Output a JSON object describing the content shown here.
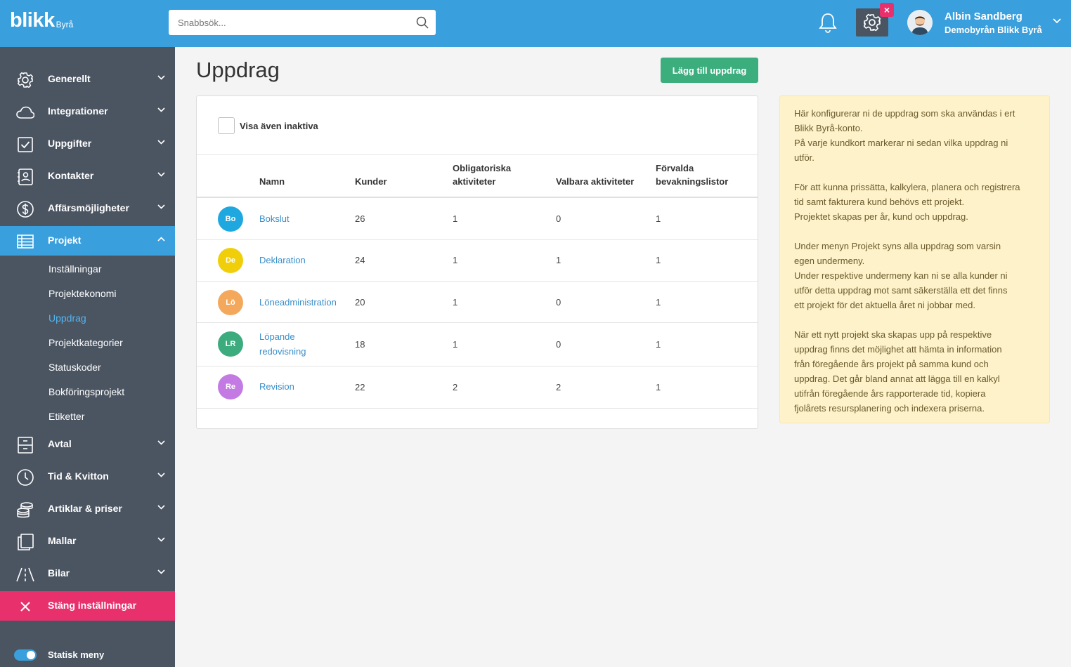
{
  "header": {
    "logo_text": "blikk",
    "logo_sub": "Byrå",
    "search_placeholder": "Snabbsök...",
    "user_name": "Albin Sandberg",
    "user_org": "Demobyrån Blikk Byrå"
  },
  "sidebar": {
    "items": [
      {
        "label": "Generellt",
        "icon": "gear-icon"
      },
      {
        "label": "Integrationer",
        "icon": "cloud-icon"
      },
      {
        "label": "Uppgifter",
        "icon": "checkbox-icon"
      },
      {
        "label": "Kontakter",
        "icon": "contact-card-icon"
      },
      {
        "label": "Affärsmöjligheter",
        "icon": "dollar-icon"
      },
      {
        "label": "Projekt",
        "icon": "table-icon"
      },
      {
        "label": "Avtal",
        "icon": "cabinet-icon"
      },
      {
        "label": "Tid & Kvitton",
        "icon": "clock-icon"
      },
      {
        "label": "Artiklar & priser",
        "icon": "coins-icon"
      },
      {
        "label": "Mallar",
        "icon": "copy-icon"
      },
      {
        "label": "Bilar",
        "icon": "road-icon"
      }
    ],
    "subitems": [
      "Inställningar",
      "Projektekonomi",
      "Uppdrag",
      "Projektkategorier",
      "Statuskoder",
      "Bokföringsprojekt",
      "Etiketter"
    ],
    "close_label": "Stäng inställningar",
    "static_menu_label": "Statisk meny"
  },
  "main": {
    "title": "Uppdrag",
    "add_button": "Lägg till uppdrag",
    "show_inactive_label": "Visa även inaktiva",
    "columns": {
      "name": "Namn",
      "customers": "Kunder",
      "mandatory_l1": "Obligatoriska",
      "mandatory_l2": "aktiviteter",
      "optional": "Valbara aktiviteter",
      "default_l1": "Förvalda",
      "default_l2": "bevakningslistor"
    },
    "rows": [
      {
        "initials": "Bo",
        "color": "#1fa8df",
        "name_l1": "Bokslut",
        "name_l2": "",
        "customers": "26",
        "mandatory": "1",
        "optional": "0",
        "default": "1"
      },
      {
        "initials": "De",
        "color": "#f0cf0a",
        "name_l1": "Deklaration",
        "name_l2": "",
        "customers": "24",
        "mandatory": "1",
        "optional": "1",
        "default": "1"
      },
      {
        "initials": "Lö",
        "color": "#f4a85c",
        "name_l1": "Löneadministration",
        "name_l2": "",
        "customers": "20",
        "mandatory": "1",
        "optional": "0",
        "default": "1"
      },
      {
        "initials": "LR",
        "color": "#3cab7e",
        "name_l1": "Löpande",
        "name_l2": "redovisning",
        "customers": "18",
        "mandatory": "1",
        "optional": "0",
        "default": "1"
      },
      {
        "initials": "Re",
        "color": "#c37be3",
        "name_l1": "Revision",
        "name_l2": "",
        "customers": "22",
        "mandatory": "2",
        "optional": "2",
        "default": "1"
      }
    ]
  },
  "info": {
    "p1": [
      "Här konfigurerar ni de uppdrag som ska användas i ert",
      "Blikk Byrå-konto.",
      "På varje kundkort markerar ni sedan vilka uppdrag ni",
      "utför."
    ],
    "p2": [
      "För att kunna prissätta, kalkylera, planera och registrera",
      "tid samt fakturera kund behövs ett projekt.",
      "Projektet skapas per år, kund och uppdrag."
    ],
    "p3": [
      "Under menyn Projekt syns alla uppdrag som varsin",
      "egen undermeny.",
      "Under respektive undermeny kan ni se alla kunder ni",
      "utför detta uppdrag mot samt säkerställa ett det finns",
      "ett projekt för det aktuella året ni jobbar med."
    ],
    "p4": [
      "När ett nytt projekt ska skapas upp på respektive",
      "uppdrag finns det möjlighet att hämta in information",
      "från föregående års projekt på samma kund och",
      "uppdrag. Det går bland annat att lägga till en kalkyl",
      "utifrån föregående års rapporterade tid, kopiera",
      "fjolårets resursplanering och indexera priserna."
    ]
  }
}
